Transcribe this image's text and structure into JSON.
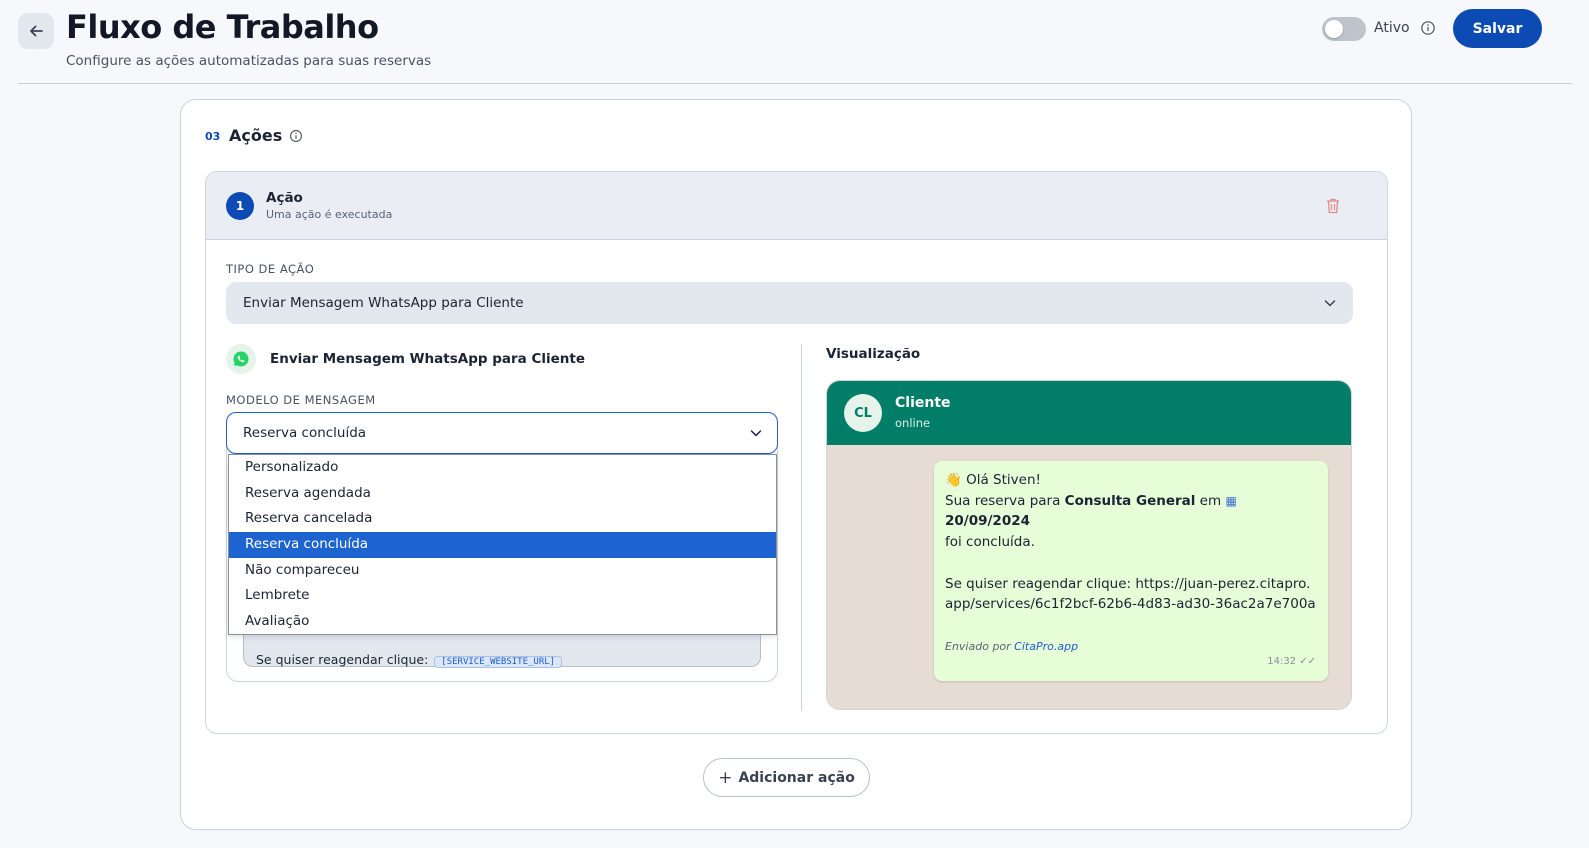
{
  "header": {
    "title": "Fluxo de Trabalho",
    "subtitle": "Configure as ações automatizadas para suas reservas",
    "toggle_label": "Ativo",
    "save_label": "Salvar"
  },
  "section": {
    "number": "03",
    "title": "Ações"
  },
  "action": {
    "step": "1",
    "title": "Ação",
    "subtitle": "Uma ação é executada",
    "type_label": "TIPO DE AÇÃO",
    "type_value": "Enviar Mensagem WhatsApp para Cliente",
    "channel_title": "Enviar Mensagem WhatsApp para Cliente",
    "template_label": "MODELO DE MENSAGEM",
    "template_value": "Reserva concluída",
    "template_options": [
      "Personalizado",
      "Reserva agendada",
      "Reserva cancelada",
      "Reserva concluída",
      "Não compareceu",
      "Lembrete",
      "Avaliação"
    ],
    "template_body_line": "Se quiser reagendar clique:",
    "template_token": "[SERVICE_WEBSITE_URL]"
  },
  "preview": {
    "title": "Visualização",
    "avatar": "CL",
    "contact_name": "Cliente",
    "contact_status": "online",
    "greeting": "Olá Stiven!",
    "line1_pre": "Sua reserva para ",
    "service": "Consulta General",
    "line1_mid": " em ",
    "date": "20/09/2024",
    "line2": "foi concluída.",
    "reschedule": "Se quiser reagendar clique: https://juan-perez.citapro.app/services/6c1f2bcf-62b6-4d83-ad30-36ac2a7e700a",
    "sent_by": "Enviado por ",
    "brand": "CitaPro.app",
    "time": "14:32 ✓✓"
  },
  "add_action_label": "Adicionar ação",
  "colors": {
    "primary": "#0b4bb3",
    "whatsapp_header": "#027d67",
    "bubble": "#e6fdd8",
    "selected": "#1e64d0"
  }
}
